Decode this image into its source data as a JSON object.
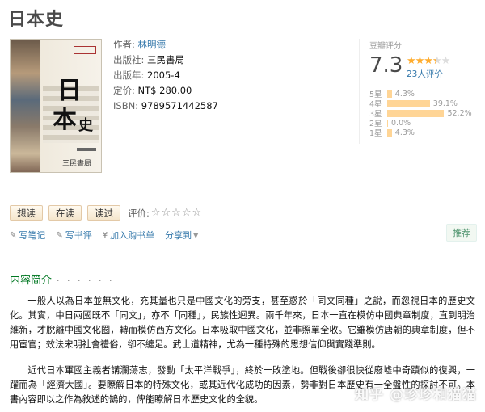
{
  "book": {
    "title": "日本史",
    "cover": {
      "edition_tag": "增訂二版",
      "title_chars": [
        "日",
        "本",
        "史"
      ],
      "publisher_text": "三民書局"
    },
    "info": {
      "author_label": "作者:",
      "author_value": "林明德",
      "publisher_label": "出版社:",
      "publisher_value": "三民書局",
      "year_label": "出版年:",
      "year_value": "2005-4",
      "price_label": "定价:",
      "price_value": "NT$ 280.00",
      "isbn_label": "ISBN:",
      "isbn_value": "9789571442587"
    }
  },
  "rating": {
    "label": "豆瓣评分",
    "score": "7.3",
    "stars_on": 3.5,
    "people": "23人评价",
    "distribution": [
      {
        "label": "5星",
        "percent": "4.3%",
        "value": 4.3
      },
      {
        "label": "4星",
        "percent": "39.1%",
        "value": 39.1
      },
      {
        "label": "3星",
        "percent": "52.2%",
        "value": 52.2
      },
      {
        "label": "2星",
        "percent": "0.0%",
        "value": 0.0
      },
      {
        "label": "1星",
        "percent": "4.3%",
        "value": 4.3
      }
    ]
  },
  "actions": {
    "want": "想读",
    "reading": "在读",
    "read": "读过",
    "rate_label": "评价:",
    "empty_stars": "☆☆☆☆☆"
  },
  "links": {
    "note": "写笔记",
    "review": "写书评",
    "cart": "加入购书单",
    "share": "分享到",
    "recommend": "推荐"
  },
  "intro": {
    "heading": "内容简介",
    "dots": "· · · · · ·",
    "p1": "一般人以為日本並無文化，充其量也只是中國文化的旁支，甚至惑於「同文同種」之說，而忽視日本的歷史文化。其實，中日兩國既不「同文」，亦不「同種」，民族性迥異。兩千年來，日本一直在模仿中國典章制度，直到明治維新，才脫離中國文化圈，轉而模仿西方文化。日本吸取中國文化，並非照單全收。它雖模仿唐朝的典章制度，但不用宦官；效法宋明社會禮俗，卻不纏足。武士道精神，尤為一種特殊的思想信仰與實踐準則。",
    "p2": "近代日本軍國主義者講瀾蕩志，發動「太平洋戰爭」，終於一敗塗地。但戰後卻很快從廢墟中奇蹟似的復興，一躍而為「經濟大國」。要瞭解日本的特殊文化，或其近代化成功的因素，勢非對日本歷史有一全盤性的探討不可。本書內容即以之作為敘述的鵠的，俾能瞭解日本歷史文化的全貌。"
  },
  "watermark": "知乎 @珍珍和猫猫",
  "colors": {
    "link": "#3377aa",
    "star": "#ffac2d",
    "bar": "#ffd596",
    "intro_heading": "#007722"
  }
}
